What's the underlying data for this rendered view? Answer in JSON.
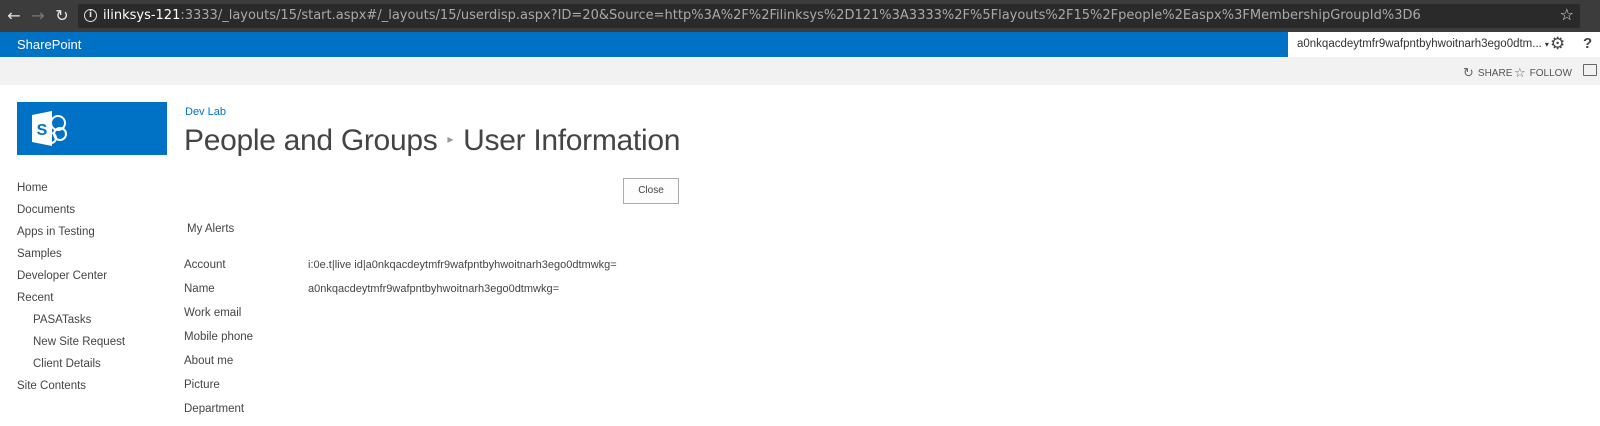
{
  "browser": {
    "back_icon": "←",
    "forward_icon": "→",
    "reload_icon": "↻",
    "info_icon": "i",
    "url_host": "ilinksys-121",
    "url_rest": ":3333/_layouts/15/start.aspx#/_layouts/15/userdisp.aspx?ID=20&Source=http%3A%2F%2Filinksys%2D121%3A3333%2F%5Flayouts%2F15%2Fpeople%2Easpx%3FMembershipGroupId%3D6",
    "star_icon": "☆"
  },
  "suite_bar": {
    "brand": "SharePoint",
    "user": "a0nkqacdeytmfr9wafpntbyhwoitnarh3ego0dtm...",
    "caret": "▾",
    "gear_icon": "⚙",
    "help_icon": "?"
  },
  "ribbon": {
    "share_icon": "↻",
    "share_label": "SHARE",
    "follow_icon": "☆",
    "follow_label": "FOLLOW"
  },
  "header": {
    "breadcrumb": "Dev Lab",
    "title_part1": "People and Groups",
    "separator": "▸",
    "title_part2": "User Information"
  },
  "nav": {
    "items": [
      {
        "label": "Home"
      },
      {
        "label": "Documents"
      },
      {
        "label": "Apps in Testing"
      },
      {
        "label": "Samples"
      },
      {
        "label": "Developer Center"
      },
      {
        "label": "Recent"
      },
      {
        "label": "PASATasks"
      },
      {
        "label": "New Site Request"
      },
      {
        "label": "Client Details"
      },
      {
        "label": "Site Contents"
      }
    ]
  },
  "main": {
    "close_label": "Close",
    "alerts_label": "My Alerts",
    "fields": [
      {
        "label": "Account",
        "value": "i:0e.t|live id|a0nkqacdeytmfr9wafpntbyhwoitnarh3ego0dtmwkg="
      },
      {
        "label": "Name",
        "value": "a0nkqacdeytmfr9wafpntbyhwoitnarh3ego0dtmwkg="
      },
      {
        "label": "Work email",
        "value": ""
      },
      {
        "label": "Mobile phone",
        "value": ""
      },
      {
        "label": "About me",
        "value": ""
      },
      {
        "label": "Picture",
        "value": ""
      },
      {
        "label": "Department",
        "value": ""
      }
    ]
  },
  "colors": {
    "suite_blue": "#0072c6",
    "chrome_dark": "#3c3c3c",
    "ribbon_gray": "#f2f2f2"
  }
}
